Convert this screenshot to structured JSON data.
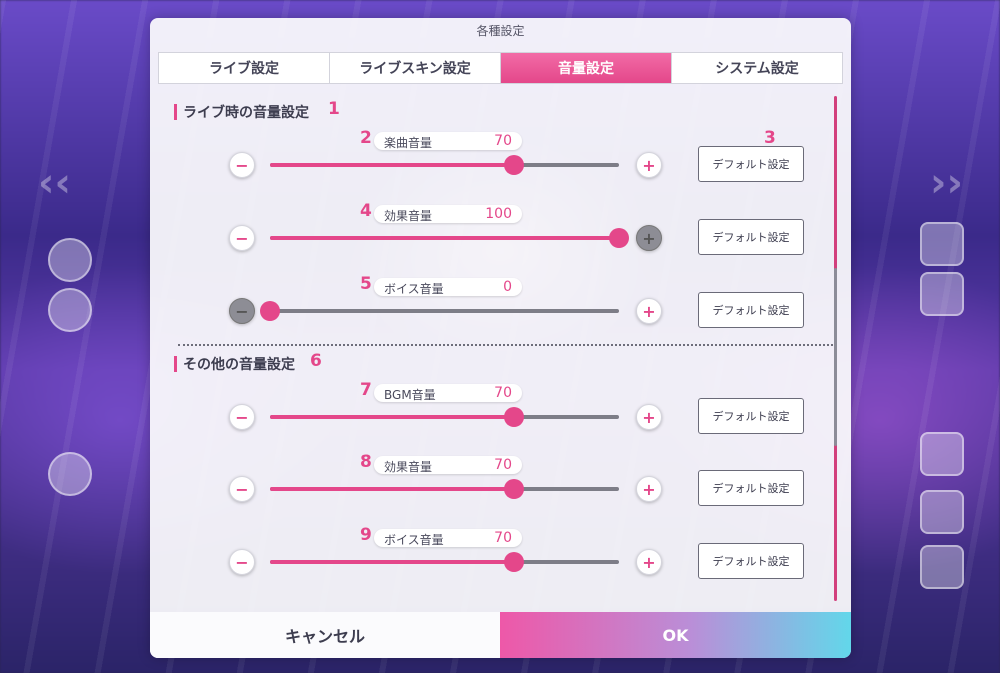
{
  "dialog": {
    "title": "各種設定"
  },
  "tabs": [
    {
      "label": "ライブ設定",
      "active": false
    },
    {
      "label": "ライブスキン設定",
      "active": false
    },
    {
      "label": "音量設定",
      "active": true
    },
    {
      "label": "システム設定",
      "active": false
    }
  ],
  "sections": [
    {
      "title": "ライブ時の音量設定",
      "number": "1"
    },
    {
      "title": "その他の音量設定",
      "number": "6"
    }
  ],
  "default_number_label": "3",
  "sliders": [
    {
      "number": "2",
      "label": "楽曲音量",
      "value": "70",
      "level": 70,
      "default_label": "デフォルト設定",
      "pressed": ""
    },
    {
      "number": "4",
      "label": "効果音量",
      "value": "100",
      "level": 100,
      "default_label": "デフォルト設定",
      "pressed": "plus"
    },
    {
      "number": "5",
      "label": "ボイス音量",
      "value": "0",
      "level": 0,
      "default_label": "デフォルト設定",
      "pressed": "minus"
    },
    {
      "number": "7",
      "label": "BGM音量",
      "value": "70",
      "level": 70,
      "default_label": "デフォルト設定",
      "pressed": ""
    },
    {
      "number": "8",
      "label": "効果音量",
      "value": "70",
      "level": 70,
      "default_label": "デフォルト設定",
      "pressed": ""
    },
    {
      "number": "9",
      "label": "ボイス音量",
      "value": "70",
      "level": 70,
      "default_label": "デフォルト設定",
      "pressed": ""
    }
  ],
  "footer": {
    "cancel_label": "キャンセル",
    "ok_label": "OK"
  },
  "icons": {
    "minus": "−",
    "plus": "+"
  },
  "colors": {
    "accent": "#e4478a"
  }
}
